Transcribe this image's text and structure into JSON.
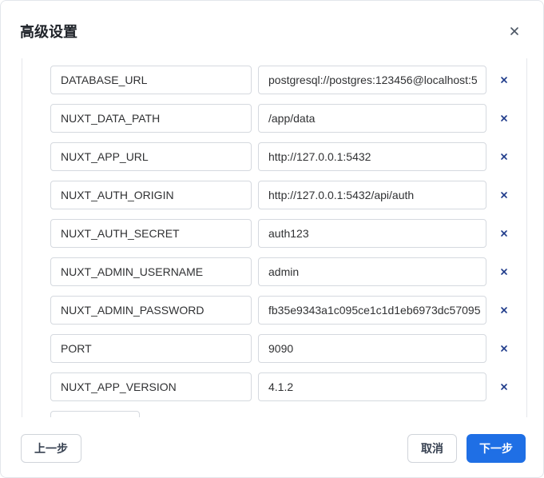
{
  "dialog": {
    "title": "高级设置",
    "close_icon": "close-icon"
  },
  "env_vars": [
    {
      "key": "DATABASE_URL",
      "value": "postgresql://postgres:123456@localhost:5"
    },
    {
      "key": "NUXT_DATA_PATH",
      "value": "/app/data"
    },
    {
      "key": "NUXT_APP_URL",
      "value": "http://127.0.0.1:5432"
    },
    {
      "key": "NUXT_AUTH_ORIGIN",
      "value": "http://127.0.0.1:5432/api/auth"
    },
    {
      "key": "NUXT_AUTH_SECRET",
      "value": "auth123"
    },
    {
      "key": "NUXT_ADMIN_USERNAME",
      "value": "admin"
    },
    {
      "key": "NUXT_ADMIN_PASSWORD",
      "value": "fb35e9343a1c095ce1c1d1eb6973dc57095"
    },
    {
      "key": "PORT",
      "value": "9090"
    },
    {
      "key": "NUXT_APP_VERSION",
      "value": "4.1.2"
    }
  ],
  "footer": {
    "prev_label": "上一步",
    "cancel_label": "取消",
    "next_label": "下一步"
  },
  "colors": {
    "primary": "#1f6fe5",
    "delete_icon": "#1e3a8a"
  }
}
